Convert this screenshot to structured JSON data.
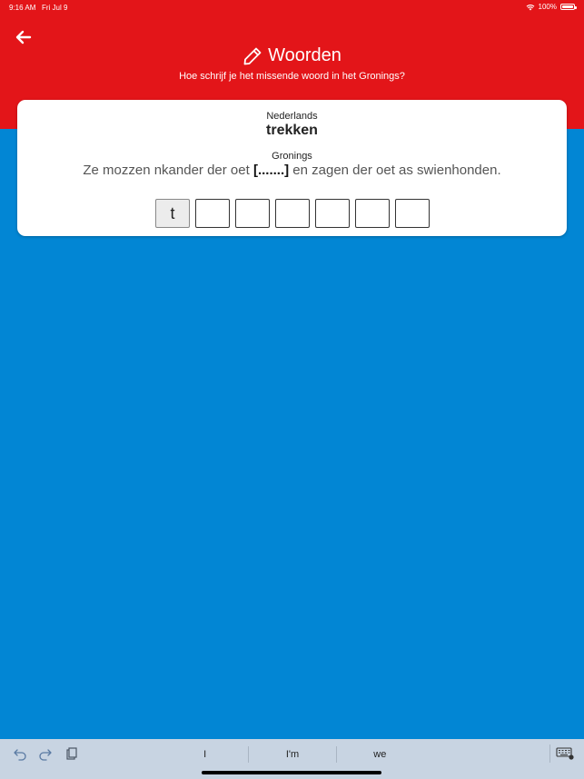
{
  "statusbar": {
    "time": "9:16 AM",
    "date": "Fri Jul 9",
    "battery": "100%"
  },
  "header": {
    "title": "Woorden",
    "subtitle": "Hoe schrijf je het missende woord in het Gronings?"
  },
  "card": {
    "source_label": "Nederlands",
    "source_word": "trekken",
    "target_label": "Gronings",
    "sentence_before": "Ze mozzen nkander der oet ",
    "gap": "[.......]",
    "sentence_after": " en zagen der oet as swienhonden.",
    "letters": [
      "t",
      "",
      "",
      "",
      "",
      "",
      ""
    ]
  },
  "keyboard": {
    "suggestions": [
      "I",
      "I'm",
      "we"
    ]
  },
  "colors": {
    "header_red": "#e31519",
    "background_blue": "#0286d4"
  }
}
